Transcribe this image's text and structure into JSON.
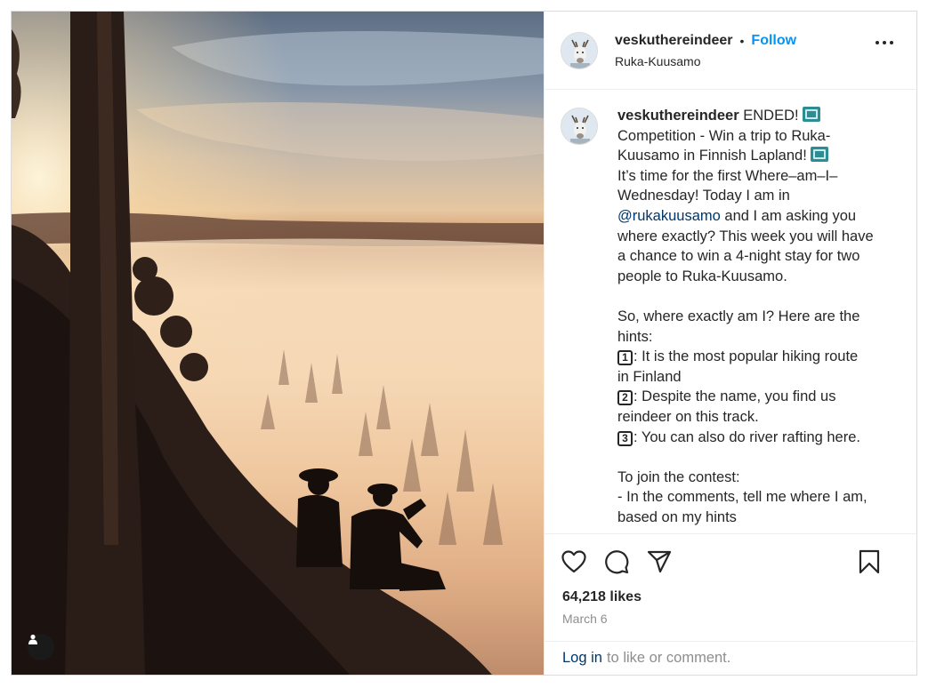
{
  "post": {
    "username": "veskuthereindeer",
    "dot": "•",
    "follow_label": "Follow",
    "location": "Ruka-Kuusamo",
    "caption": {
      "part1": " ENDED! ",
      "part2": "\nCompetition - Win a trip to Ruka-\nKuusamo in Finnish Lapland! ",
      "part3": "\nIt’s time for the first Where–am–I–\nWednesday! Today I am in\n",
      "mention": "@rukakuusamo",
      "part4": " and I am asking you\nwhere exactly? This week you will have\na chance to win a 4-night stay for two\npeople to Ruka-Kuusamo.\n\nSo, where exactly am I? Here are the\nhints:\n",
      "hint1_num": "1",
      "hint1": ": It is the most popular hiking route\nin Finland\n",
      "hint2_num": "2",
      "hint2": ": Despite the name, you find us\nreindeer on this track.\n",
      "hint3_num": "3",
      "hint3": ": You can also do river rafting here.\n\nTo join the contest:\n- In the comments, tell me where I am,\nbased on my hints"
    },
    "likes": "64,218 likes",
    "date": "March 6",
    "login_link": "Log in",
    "login_text": "to like or comment."
  },
  "icons": {
    "more": "more-options-icon",
    "like": "heart-icon",
    "comment": "comment-icon",
    "share": "share-icon",
    "save": "bookmark-icon",
    "tag": "user-tag-icon",
    "emoji": "world-map-emoji"
  },
  "colors": {
    "follow": "#0095f6",
    "mention": "#00376b",
    "muted": "#8e8e8e",
    "border": "#dbdbdb"
  }
}
